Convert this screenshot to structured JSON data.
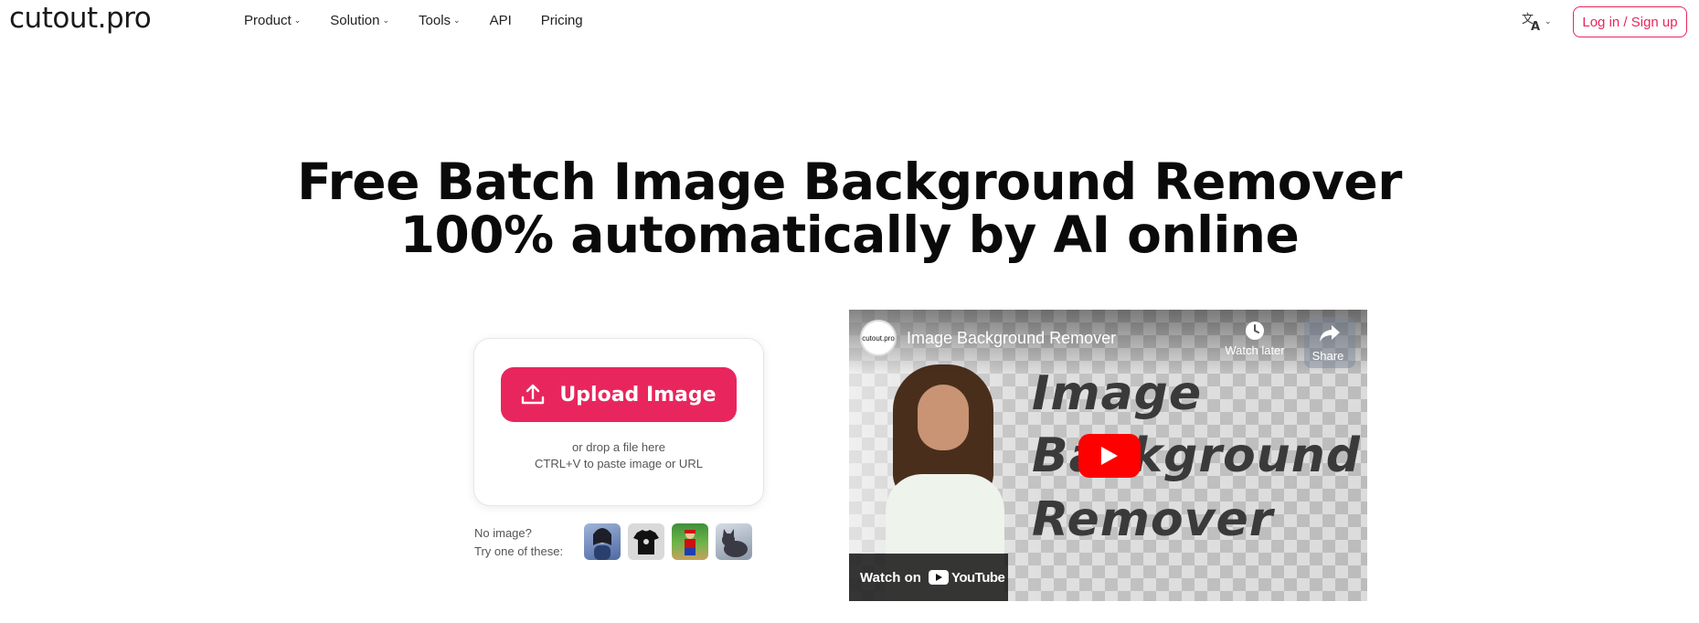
{
  "header": {
    "logo": "cutout.pro",
    "nav": [
      {
        "label": "Product",
        "dropdown": true
      },
      {
        "label": "Solution",
        "dropdown": true
      },
      {
        "label": "Tools",
        "dropdown": true
      },
      {
        "label": "API",
        "dropdown": false
      },
      {
        "label": "Pricing",
        "dropdown": false
      }
    ],
    "language_icon": "translate-icon",
    "login_label": "Log in / Sign up"
  },
  "hero": {
    "line1": "Free Batch Image Background Remover",
    "line2": "100% automatically by AI online"
  },
  "upload": {
    "button_label": "Upload Image",
    "drop_text": "or drop a file here",
    "paste_text": "CTRL+V to paste image or URL"
  },
  "samples": {
    "label_line1": "No image?",
    "label_line2": "Try one of these:"
  },
  "video": {
    "title": "Image Background Remover",
    "channel_avatar_text": "cutout.pro",
    "watch_later": "Watch later",
    "share": "Share",
    "watch_on": "Watch on",
    "youtube": "YouTube",
    "overlay_words": [
      "Image",
      "Background",
      "Remover"
    ]
  },
  "colors": {
    "accent": "#e8265d",
    "youtube_red": "#ff0000"
  }
}
